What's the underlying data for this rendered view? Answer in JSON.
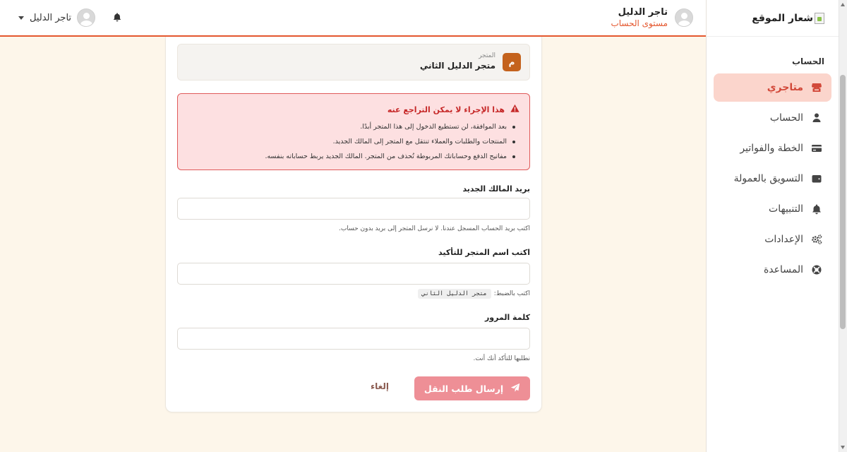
{
  "header": {
    "user_name": "تاجر الدليل",
    "account_level": "مستوى الحساب",
    "mini_user_name": "تاجر الدليل"
  },
  "sidebar": {
    "logo_text": "شعار الموقع",
    "section_title": "الحساب",
    "items": [
      {
        "label": "متاجري",
        "icon": "store-icon",
        "active": true
      },
      {
        "label": "الحساب",
        "icon": "user-icon"
      },
      {
        "label": "الخطة والفواتير",
        "icon": "credit-card-icon"
      },
      {
        "label": "التسويق بالعمولة",
        "icon": "wallet-icon"
      },
      {
        "label": "التنبيهات",
        "icon": "bell-icon"
      },
      {
        "label": "الإعدادات",
        "icon": "gears-icon"
      },
      {
        "label": "المساعدة",
        "icon": "lifebuoy-icon"
      }
    ]
  },
  "store": {
    "label": "المتجر",
    "name": "متجر الدليل الثاني",
    "badge": "م",
    "badge_color": "#c4621d"
  },
  "warning": {
    "title": "هذا الإجراء لا يمكن التراجع عنه",
    "bullets": [
      "بعد الموافقة، لن تستطيع الدخول إلى هذا المتجر أبدًا.",
      "المنتجات والطلبات والعملاء تنتقل مع المتجر إلى المالك الجديد.",
      "مفاتيح الدفع وحساباتك المربوطة تُحذف من المتجر. المالك الجديد يربط حساباته بنفسه."
    ]
  },
  "form": {
    "email_label": "بريد المالك الجديد",
    "email_value": "",
    "email_help": "اكتب بريد الحساب المسجل عندنا. لا نرسل المتجر إلى بريد بدون حساب.",
    "confirm_label": "اكتب اسم المتجر للتأكيد",
    "confirm_value": "",
    "confirm_help_prefix": "اكتب بالضبط:",
    "confirm_help_code": "متجر الدليل الثاني",
    "password_label": "كلمة المرور",
    "password_value": "",
    "password_help": "نطلبها للتأكد أنك أنت.",
    "submit_label": "إرسال طلب النقل",
    "cancel_label": "إلغاء"
  },
  "colors": {
    "accent": "#e4572e",
    "active_bg": "#fbd5cc",
    "warning_bg": "#fde0e1",
    "warning_border": "#e05a5a",
    "submit_bg": "#ee8f96"
  }
}
